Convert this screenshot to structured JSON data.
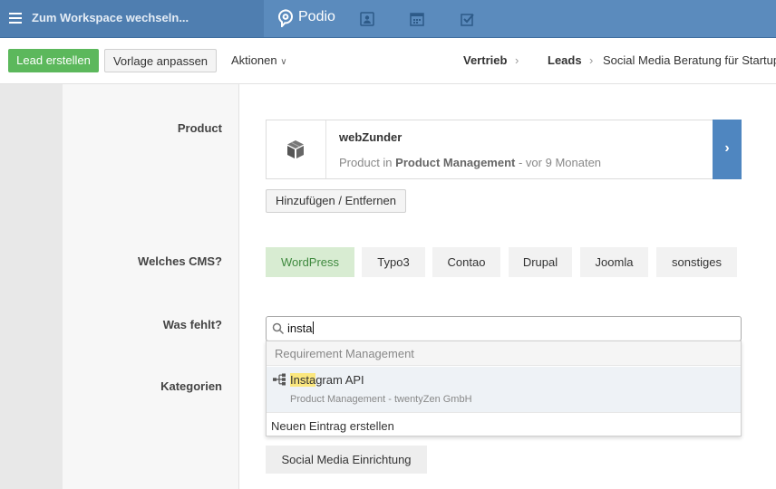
{
  "topbar": {
    "workspace_switch": "Zum Workspace wechseln...",
    "brand": "Podio",
    "icons": [
      "contacts-icon",
      "calendar-icon",
      "tasks-icon"
    ]
  },
  "actionbar": {
    "create_lead": "Lead erstellen",
    "customize_template": "Vorlage anpassen",
    "actions": "Aktionen",
    "breadcrumb": {
      "workspace": "Vertrieb",
      "app": "Leads",
      "item": "Social Media Beratung für Startups"
    }
  },
  "fields": {
    "product": {
      "label": "Product",
      "card_title": "webZunder",
      "card_sub_prefix": "Product in",
      "card_sub_app": "Product Management",
      "card_sub_time": "- vor 9 Monaten",
      "add_remove": "Hinzufügen / Entfernen"
    },
    "cms": {
      "label": "Welches CMS?",
      "options": [
        "WordPress",
        "Typo3",
        "Contao",
        "Drupal",
        "Joomla",
        "sonstiges"
      ],
      "selected": "WordPress"
    },
    "missing": {
      "label": "Was fehlt?",
      "search_value": "insta",
      "dropdown": {
        "section": "Requirement Management",
        "item_highlight": "Insta",
        "item_rest": "gram API",
        "item_sub": "Product Management - twentyZen GmbH",
        "new_entry": "Neuen Eintrag erstellen"
      }
    },
    "categories": {
      "label": "Kategorien",
      "tag": "Social Media Einrichtung"
    }
  },
  "colors": {
    "topbar": "#5b8bbd",
    "green": "#5cb85c",
    "selected_option": "#d8ecd2",
    "arrow": "#4f86c0",
    "highlight": "#fbe77e"
  }
}
